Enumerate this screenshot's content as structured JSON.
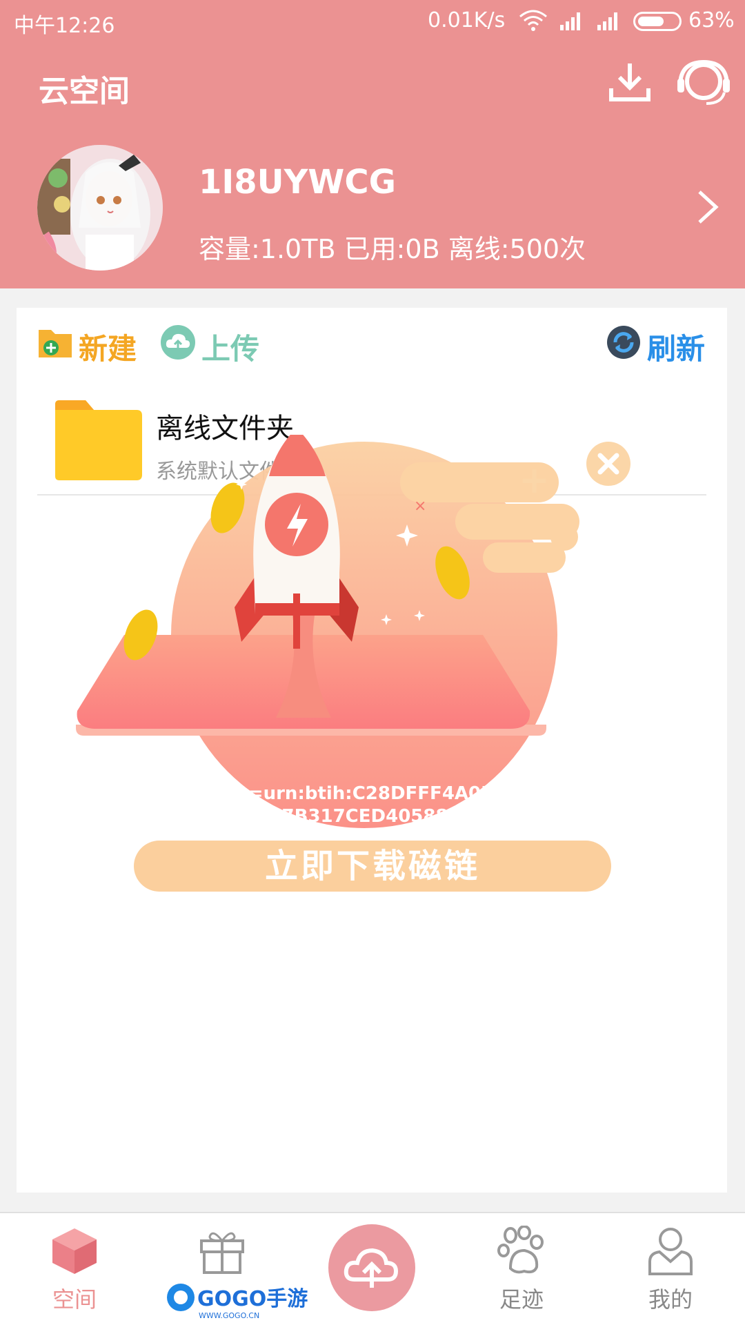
{
  "status_bar": {
    "time": "中午12:26",
    "net_speed": "0.01K/s",
    "battery_pct": "63%",
    "battery_level": 0.63
  },
  "header": {
    "title": "云空间",
    "username": "1I8UYWCG",
    "quota": "容量:1.0TB 已用:0B 离线:500次",
    "icons": [
      "download-icon",
      "headset-icon",
      "chevron-right-icon"
    ]
  },
  "toolbar": {
    "new_label": "新建",
    "upload_label": "上传",
    "refresh_label": "刷新"
  },
  "folders": [
    {
      "name": "离线文件夹",
      "subtitle": "系统默认文件夹"
    }
  ],
  "popup": {
    "magnet_text": "magnet:?xt=urn:btih:C28DFFF4A0F5DA7B8B443E77B317CED405884D89",
    "button_label": "立即下载磁链",
    "close_icon": "close-icon"
  },
  "bottom_nav": {
    "space": "空间",
    "gift": "",
    "track": "足迹",
    "mine": "我的",
    "fab_icon": "cloud-upload-icon"
  },
  "watermark": {
    "text": "GOGO手游网",
    "sub": "WWW.GOGO.CN"
  },
  "colors": {
    "header": "#eb9292",
    "new": "#f4a623",
    "upload": "#7ccab3",
    "refresh": "#2a8fe8",
    "accent": "#eb9292"
  }
}
